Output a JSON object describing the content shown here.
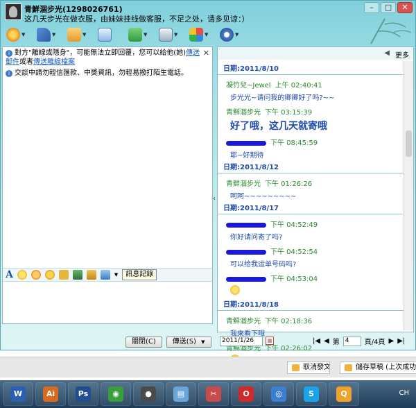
{
  "header": {
    "title": "青鮮涸步光(1298026761)",
    "signature": "这几天步光在做衣服，由妹妹挂线做客服，不足之处，请多见谅：）"
  },
  "window_controls": {
    "minimize": "–",
    "maximize": "□",
    "close": "✕"
  },
  "toolbar": {
    "items": [
      {
        "icon": "video-call-icon"
      },
      {
        "icon": "voice-call-icon"
      },
      {
        "icon": "send-file-icon"
      },
      {
        "icon": "send-email-icon"
      },
      {
        "icon": "create-group-icon"
      },
      {
        "icon": "remote-assist-icon"
      },
      {
        "icon": "apps-icon"
      },
      {
        "icon": "settings-icon"
      }
    ]
  },
  "notices": {
    "first_prefix": "對方\"離線或隱身\"，可能無法立即回覆，您可以給他(她)",
    "first_link1": "傳送郵件",
    "first_mid": "或者",
    "first_link2": "傳送離線檔案",
    "second": "交談中請勿輕信匯款、中獎資訊，勿輕易撥打陌生電話。",
    "close": "✕"
  },
  "format_bar": {
    "font_letter": "A",
    "message_record": "訊息記錄"
  },
  "buttons": {
    "close": "關閉(C)",
    "send": "傳送(S)",
    "send_dropdown": "▼"
  },
  "history_panel": {
    "more": "更多",
    "entries": [
      {
        "date": "日期:2011/8/10"
      },
      {
        "sender": "凝竹兒~Jewel",
        "time": "上午 02:40:41",
        "message": "步光光~请问我的卿卿好了吗?~~"
      },
      {
        "sender": "青鮮涸步光",
        "time": "下午 03:15:39",
        "message": "好了哦，这几天就寄哦",
        "big": true
      },
      {
        "sender": "",
        "time": "下午 08:45:59",
        "message": "耶~好期待"
      },
      {
        "date": "日期:2011/8/12"
      },
      {
        "sender": "青鮮涸步光",
        "time": "下午 01:26:26",
        "message": "呵呵~~~~~~~~~"
      },
      {
        "date": "日期:2011/8/17"
      },
      {
        "sender": "",
        "time": "下午 04:52:49",
        "message": "你好请问寄了吗?"
      },
      {
        "sender": "",
        "time": "下午 04:52:54",
        "message": "可以给我运单号码吗?"
      },
      {
        "sender": "",
        "time": "下午 04:53:04",
        "message": ""
      },
      {
        "date": "日期:2011/8/18"
      },
      {
        "sender": "青鮮涸步光",
        "time": "下午 02:18:36",
        "message": "我來看下哦"
      },
      {
        "sender": "青鮮涸步光",
        "time": "下午 02:26:02",
        "message": ""
      }
    ]
  },
  "pager": {
    "date": "2011/1/26",
    "first": "|◀",
    "prev": "◀",
    "page_prefix": "第",
    "page_value": "4",
    "page_suffix": "頁/4頁",
    "next": "▶",
    "last": "▶|"
  },
  "strip": {
    "cancel_post": "取消發文",
    "save_draft": "儲存草稿 (上次成功"
  },
  "taskbar": {
    "apps": [
      {
        "name": "word",
        "glyph": "W",
        "color": "#2b5fb4"
      },
      {
        "name": "illustrator",
        "glyph": "Ai",
        "color": "#d76a1e"
      },
      {
        "name": "photoshop",
        "glyph": "Ps",
        "color": "#1f4f8f"
      },
      {
        "name": "chrome",
        "glyph": "◉",
        "color": "#3a9f3a"
      },
      {
        "name": "media",
        "glyph": "●",
        "color": "#4a4a4a"
      },
      {
        "name": "notes",
        "glyph": "▤",
        "color": "#6aa7d8"
      },
      {
        "name": "snipping",
        "glyph": "✂",
        "color": "#c94a4a"
      },
      {
        "name": "opera",
        "glyph": "O",
        "color": "#d12a2a"
      },
      {
        "name": "safari",
        "glyph": "◎",
        "color": "#3c7fd0"
      },
      {
        "name": "skype",
        "glyph": "S",
        "color": "#1aa3e8"
      },
      {
        "name": "qq",
        "glyph": "Q",
        "color": "#f0a32a"
      }
    ],
    "lang": "CH"
  }
}
